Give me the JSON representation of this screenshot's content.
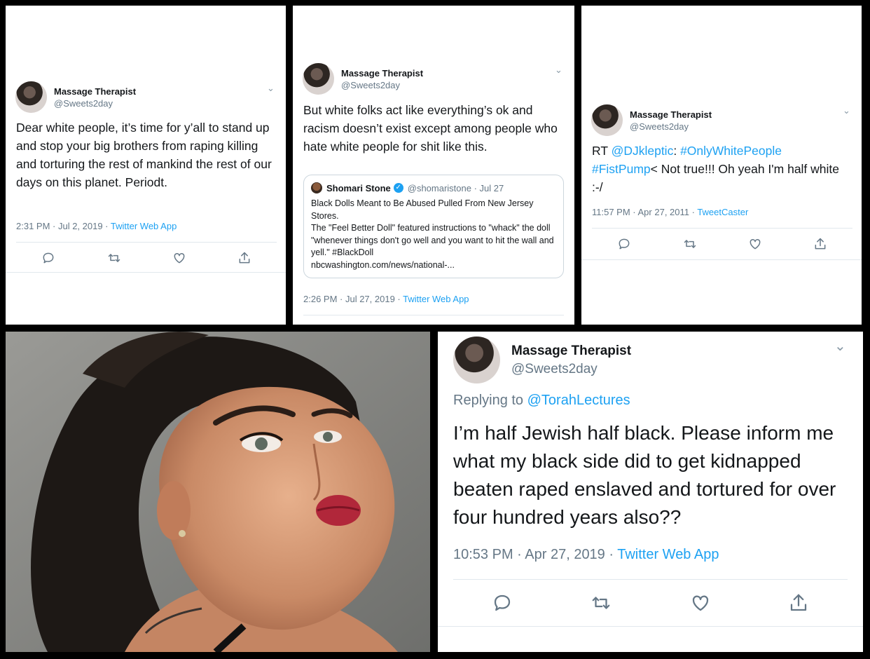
{
  "tweet1": {
    "display_name": "Massage Therapist",
    "handle": "@Sweets2day",
    "text": "Dear white people, it’s time for y’all to stand up and stop your big brothers from raping killing and torturing the rest of mankind the rest of our days on this planet. Periodt.",
    "time": "2:31 PM · Jul 2, 2019 · ",
    "source": "Twitter Web App"
  },
  "tweet2": {
    "display_name": "Massage Therapist",
    "handle": "@Sweets2day",
    "text": "But white folks act like everything’s ok and racism doesn’t exist except among people who hate white people for shit like this.",
    "quote": {
      "author": "Shomari Stone",
      "handle_date": "@shomaristone · Jul 27",
      "line1": "Black Dolls Meant to Be Abused Pulled From New Jersey Stores.",
      "line2": "The \"Feel Better Doll\" featured instructions to \"whack\" the doll \"whenever things don't go well and you want to hit the wall and yell.\" #BlackDoll",
      "line3": "nbcwashington.com/news/national-..."
    },
    "time": "2:26 PM · Jul 27, 2019 · ",
    "source": "Twitter Web App"
  },
  "tweet3": {
    "display_name": "Massage Therapist",
    "handle": "@Sweets2day",
    "rt": "RT ",
    "mention": "@DJkleptic",
    "colon": ": ",
    "hashtag1": "#OnlyWhitePeople",
    "hashtag2": "#FistPump",
    "rest": "< Not true!!! Oh yeah I'm half white :-/",
    "time": "11:57 PM · Apr 27, 2011 · ",
    "source": "TweetCaster"
  },
  "tweet4": {
    "display_name": "Massage Therapist",
    "handle": "@Sweets2day",
    "replying_prefix": "Replying to ",
    "replying_to": "@TorahLectures",
    "text": "I’m half Jewish half black. Please inform me what my black side did to get kidnapped beaten raped enslaved and tortured for over four hundred years also??",
    "time": "10:53 PM · Apr 27, 2019 · ",
    "source": "Twitter Web App"
  },
  "colors": {
    "link": "#1da1f2",
    "muted": "#657786",
    "background": "#000000"
  },
  "icons": [
    "reply-icon",
    "retweet-icon",
    "like-icon",
    "share-icon",
    "chevron-down-icon",
    "verified-icon"
  ]
}
